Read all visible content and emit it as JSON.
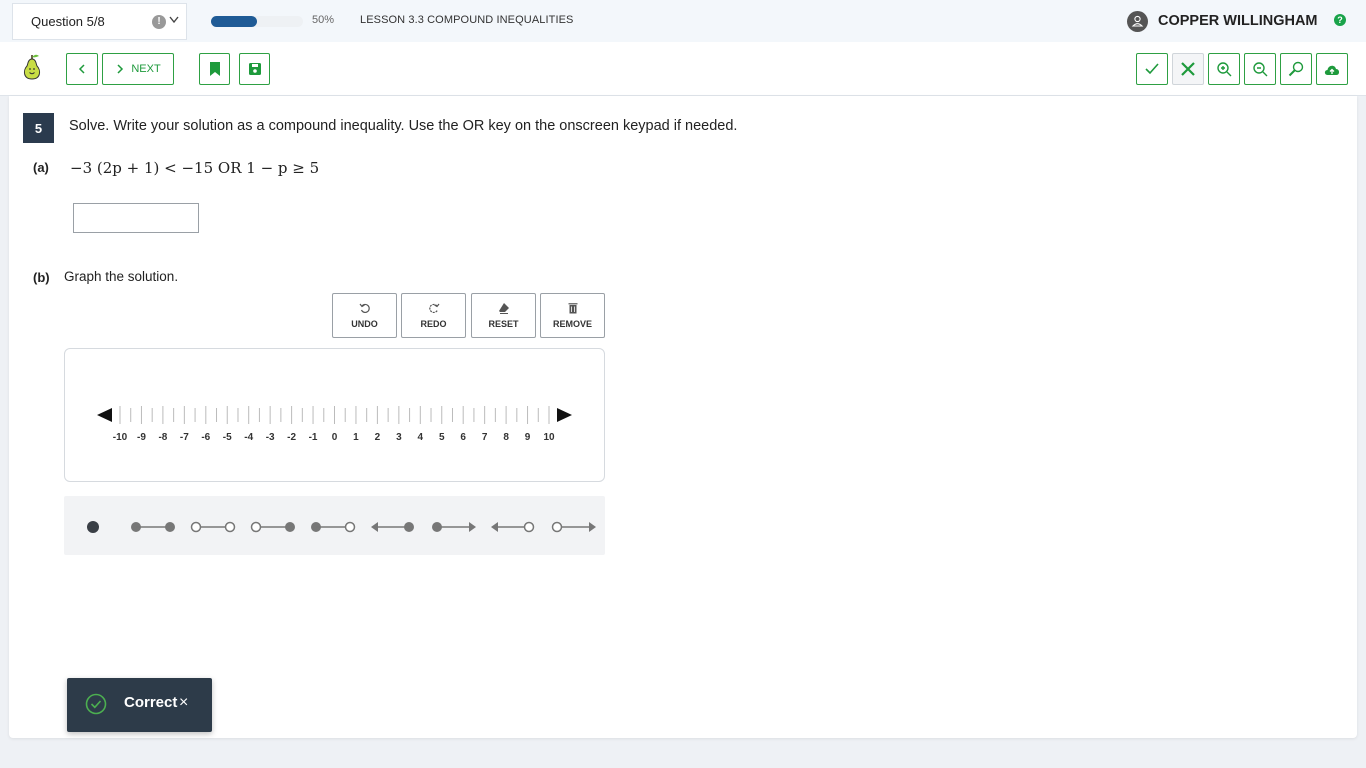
{
  "header": {
    "question_selector": "Question 5/8",
    "progress_label": "50%",
    "progress_value": 0.5,
    "lesson_title": "LESSON 3.3 COMPOUND INEQUALITIES",
    "user_name": "COPPER WILLINGHAM",
    "help_glyph": "?",
    "flag_glyph": "!"
  },
  "toolbar": {
    "next_label": "NEXT",
    "accent_color": "#2ea043"
  },
  "question": {
    "number": "5",
    "prompt": "Solve.  Write your solution as a compound inequality. Use the OR key on the onscreen keypad if needed.",
    "part_a_label": "(a)",
    "part_a_math": "−3 (2p + 1) < −15 OR 1 − p ≥ 5",
    "answer_value": "",
    "part_b_label": "(b)",
    "part_b_text": "Graph the solution."
  },
  "graph_controls": {
    "undo": "UNDO",
    "redo": "REDO",
    "reset": "RESET",
    "remove": "REMOVE"
  },
  "number_line": {
    "min": -10,
    "max": 10,
    "tick_labels": [
      "-10",
      "-9",
      "-8",
      "-7",
      "-6",
      "-5",
      "-4",
      "-3",
      "-2",
      "-1",
      "0",
      "1",
      "2",
      "3",
      "4",
      "5",
      "6",
      "7",
      "8",
      "9",
      "10"
    ]
  },
  "tools": [
    "point-tool",
    "closed-closed-segment-tool",
    "open-open-segment-tool",
    "open-closed-segment-tool",
    "closed-open-segment-tool",
    "left-ray-closed-tool",
    "right-ray-closed-tool",
    "left-ray-open-tool",
    "right-ray-open-tool"
  ],
  "toast": {
    "message": "Correct",
    "close_glyph": "×",
    "status_color": "#4caf50"
  }
}
